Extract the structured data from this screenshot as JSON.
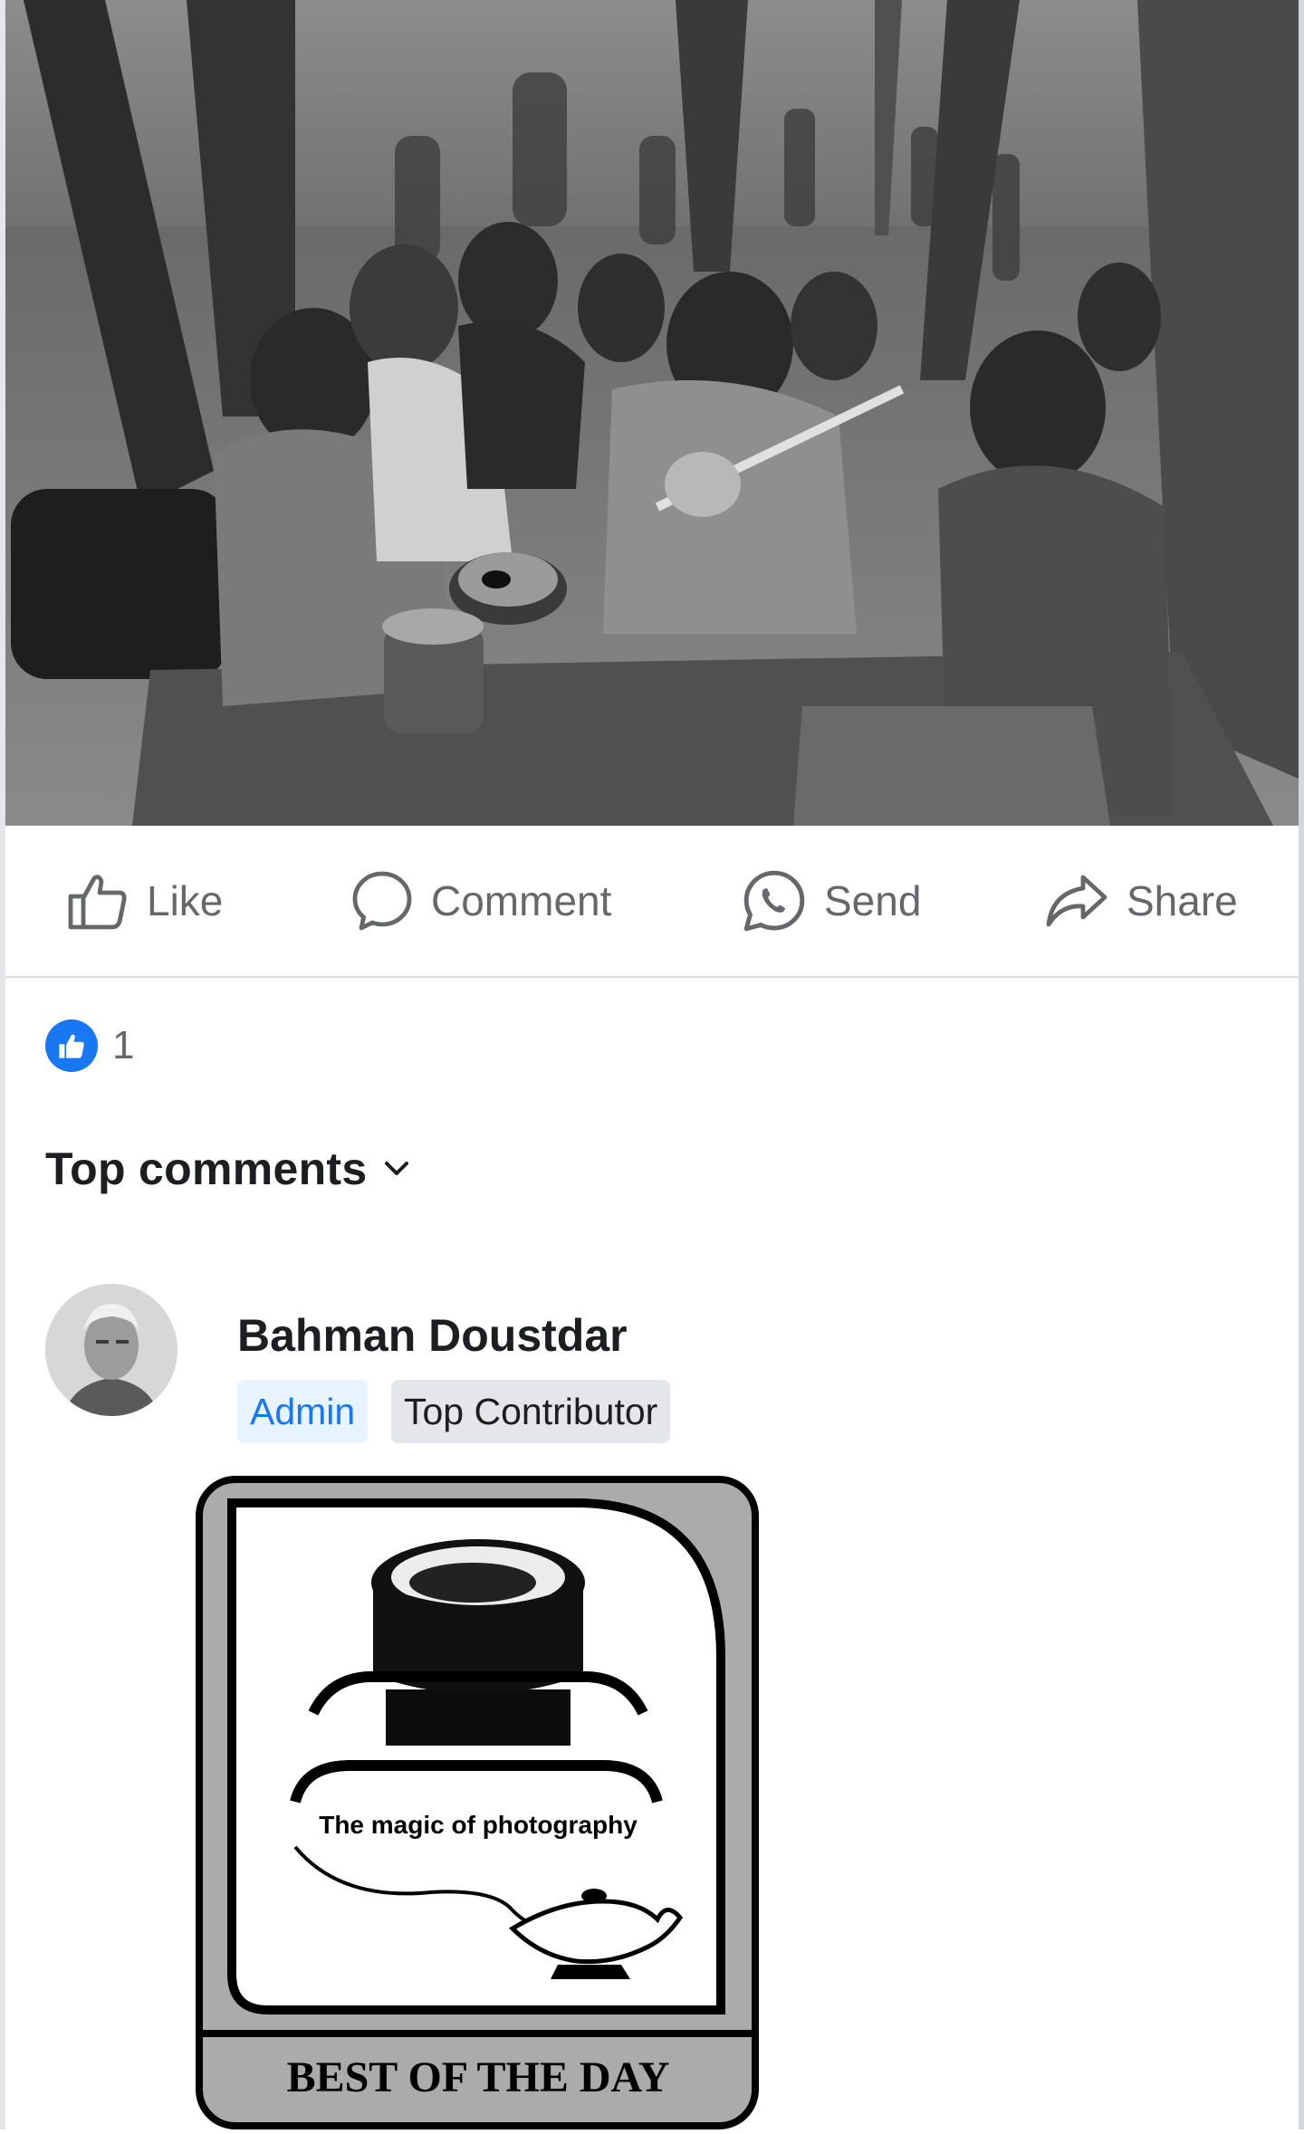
{
  "post": {
    "photo_alt": "photo",
    "actions": [
      {
        "label": "Like",
        "icon": "thumbs-up-icon"
      },
      {
        "label": "Comment",
        "icon": "speech-bubble-icon"
      },
      {
        "label": "Send",
        "icon": "whatsapp-icon"
      },
      {
        "label": "Share",
        "icon": "share-arrow-icon"
      }
    ],
    "reaction_count": "1"
  },
  "comments": {
    "sort_label": "Top comments",
    "items": [
      {
        "author": "Bahman Doustdar",
        "badges": [
          "Admin",
          "Top Contributor"
        ],
        "sticker": {
          "tagline": "The magic of photography",
          "banner": "BEST OF THE DAY"
        }
      }
    ]
  },
  "colors": {
    "accent": "#1877f2",
    "secondary_text": "#65676b",
    "primary_text": "#1c1e21",
    "admin_badge_bg": "#e7f3ff",
    "contributor_badge_bg": "#e4e6eb",
    "divider": "#dadde1"
  }
}
